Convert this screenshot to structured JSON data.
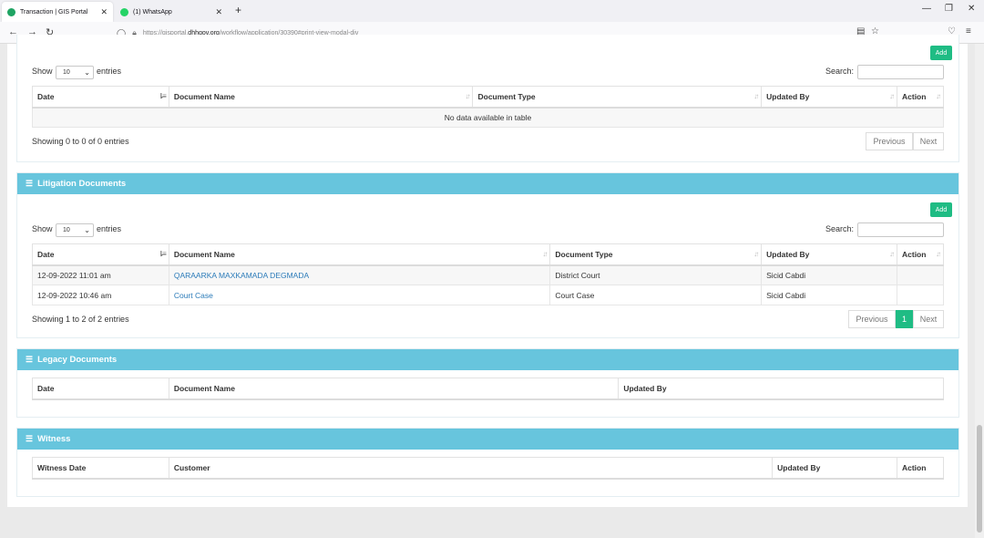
{
  "browser": {
    "tabs": [
      {
        "title": "Transaction | GIS Portal",
        "active": true
      },
      {
        "title": "(1) WhatsApp",
        "active": false
      }
    ],
    "url_prefix": "https://gisportal.",
    "url_host": "dhhgov.org",
    "url_path": "/workflow/application/30390#print-view-modal-div"
  },
  "colors": {
    "section_header": "#67c5dd",
    "add_button": "#1fbc84",
    "link": "#2b7bb9"
  },
  "common": {
    "show": "Show",
    "entries": "entries",
    "search": "Search:",
    "page_length": "10",
    "add": "Add",
    "previous": "Previous",
    "next": "Next"
  },
  "documents_table": {
    "columns": [
      "Date",
      "Document Name",
      "Document Type",
      "Updated By",
      "Action"
    ],
    "empty_message": "No data available in table",
    "info": "Showing 0 to 0 of 0 entries"
  },
  "litigation": {
    "title": "Litigation Documents",
    "columns": [
      "Date",
      "Document Name",
      "Document Type",
      "Updated By",
      "Action"
    ],
    "rows": [
      {
        "date": "12-09-2022 11:01 am",
        "name": "QARAARKA MAXKAMADA DEGMADA",
        "type": "District Court",
        "updated_by": "Sicid Cabdi",
        "action": ""
      },
      {
        "date": "12-09-2022 10:46 am",
        "name": "Court Case",
        "type": "Court Case",
        "updated_by": "Sicid Cabdi",
        "action": ""
      }
    ],
    "info": "Showing 1 to 2 of 2 entries",
    "current_page": "1"
  },
  "legacy": {
    "title": "Legacy Documents",
    "columns": [
      "Date",
      "Document Name",
      "Updated By"
    ]
  },
  "witness": {
    "title": "Witness",
    "columns": [
      "Witness Date",
      "Customer",
      "Updated By",
      "Action"
    ]
  }
}
